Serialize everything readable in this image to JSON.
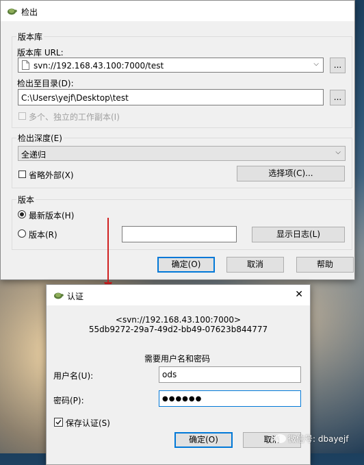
{
  "checkout": {
    "title": "检出",
    "repo_group": "版本库",
    "repo_url_label": "版本库 URL:",
    "repo_url_value": "svn://192.168.43.100:7000/test",
    "checkout_dir_label": "检出至目录(D):",
    "checkout_dir_value": "C:\\Users\\yejf\\Desktop\\test",
    "browse_label": "...",
    "multi_wc_label": "多个、独立的工作副本(I)",
    "depth_group": "检出深度(E)",
    "depth_value": "全递归",
    "omit_externals_label": "省略外部(X)",
    "options_button": "选择项(C)...",
    "revision_group": "版本",
    "head_revision_label": "最新版本(H)",
    "revision_label": "版本(R)",
    "revision_value": "",
    "show_log_button": "显示日志(L)",
    "ok_button": "确定(O)",
    "cancel_button": "取消",
    "help_button": "帮助"
  },
  "auth": {
    "title": "认证",
    "realm_line1": "<svn://192.168.43.100:7000>",
    "realm_line2": "55db9272-29a7-49d2-bb49-07623b844777",
    "prompt": "需要用户名和密码",
    "username_label": "用户名(U):",
    "username_value": "ods",
    "password_label": "密码(P):",
    "password_value": "●●●●●●",
    "save_label": "保存认证(S)",
    "ok_button": "确定(O)",
    "cancel_button": "取消",
    "close_glyph": "✕"
  },
  "watermark": "微信号: dbayejf",
  "colors": {
    "focus": "#0078d7",
    "arrow": "#d02020"
  }
}
